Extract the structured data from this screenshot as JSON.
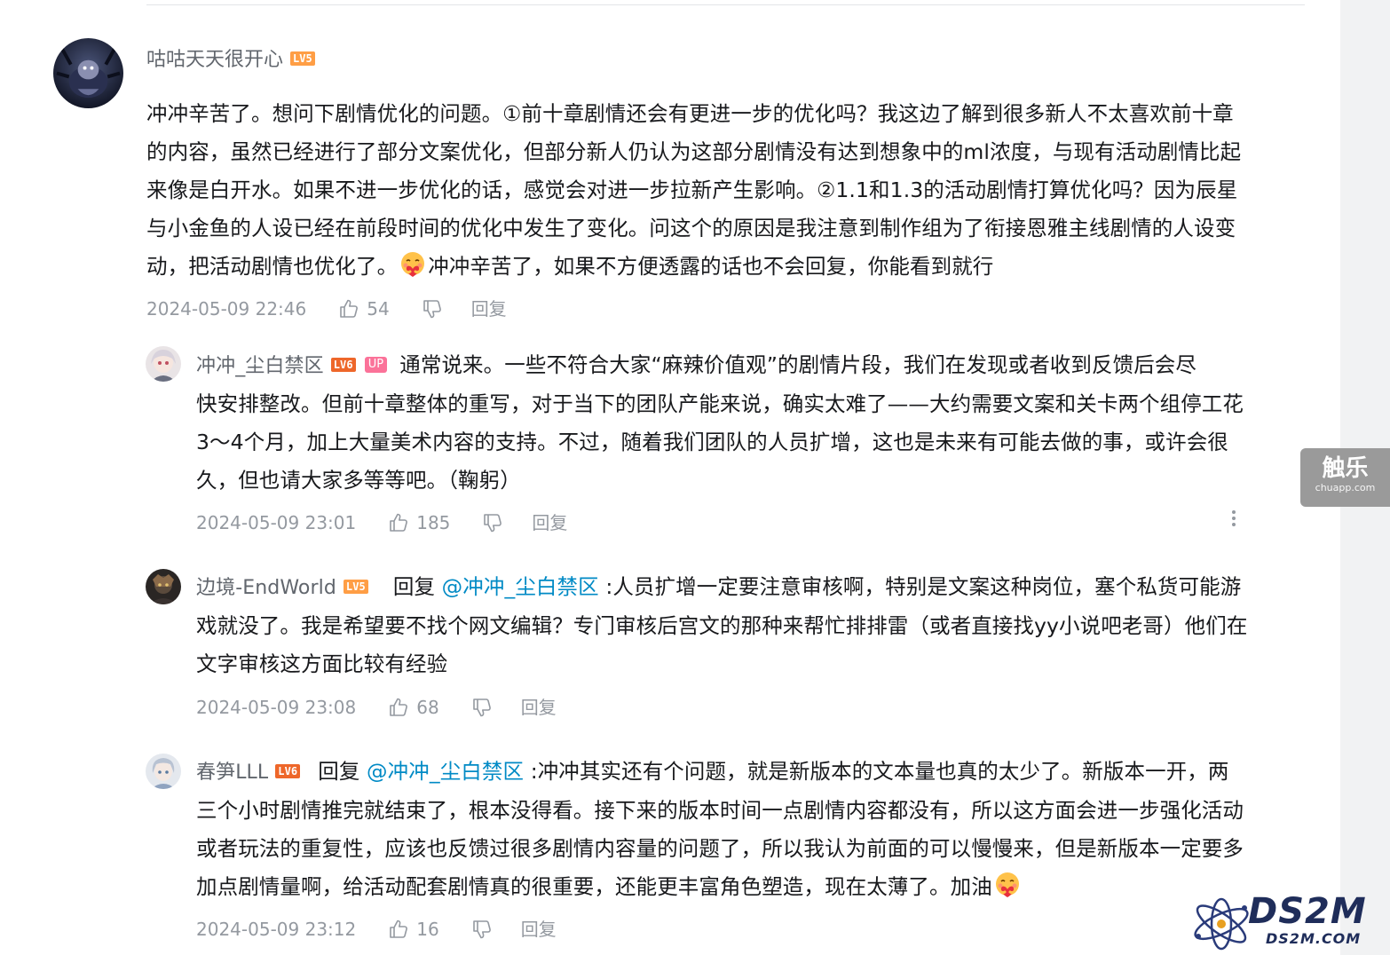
{
  "comments": [
    {
      "username": "咕咕天天很开心",
      "level": "LV5",
      "text_lines": [
        "冲冲辛苦了。想问下剧情优化的问题。①前十章剧情还会有更进一步的优化吗？我这边了解到很多新人不太喜欢前十章",
        "的内容，虽然已经进行了部分文案优化，但部分新人仍认为这部分剧情没有达到想象中的ml浓度，与现有活动剧情比起",
        "来像是白开水。如果不进一步优化的话，感觉会对进一步拉新产生影响。②1.1和1.3的活动剧情打算优化吗？因为辰星",
        "与小金鱼的人设已经在前段时间的优化中发生了变化。问这个的原因是我注意到制作组为了衔接恩雅主线剧情的人设变"
      ],
      "last_line_before_emoji": "动，把活动剧情也优化了。",
      "last_line_after_emoji": "冲冲辛苦了，如果不方便透露的话也不会回复，你能看到就行",
      "time": "2024-05-09 22:46",
      "likes": "54",
      "reply_label": "回复"
    },
    {
      "username": "冲冲_尘白禁区",
      "level": "LV6",
      "up_tag": "UP",
      "first_line": "通常说来。一些不符合大家“麻辣价值观”的剧情片段，我们在发现或者收到反馈后会尽",
      "text_lines": [
        "快安排整改。但前十章整体的重写，对于当下的团队产能来说，确实太难了——大约需要文案和关卡两个组停工花",
        "3～4个月，加上大量美术内容的支持。不过，随着我们团队的人员扩增，这也是未来有可能去做的事，或许会很",
        "久，但也请大家多等等吧。（鞠躬）"
      ],
      "time": "2024-05-09 23:01",
      "likes": "185",
      "reply_label": "回复"
    },
    {
      "username": "边境-EndWorld",
      "level": "LV5",
      "reply_prefix": "回复",
      "mention": "@冲冲_尘白禁区",
      "first_line": ":人员扩增一定要注意审核啊，特别是文案这种岗位，塞个私货可能游",
      "text_lines": [
        "戏就没了。我是希望要不找个网文编辑？专门审核后宫文的那种来帮忙排排雷（或者直接找yy小说吧老哥）他们在",
        "文字审核这方面比较有经验"
      ],
      "time": "2024-05-09 23:08",
      "likes": "68",
      "reply_label": "回复"
    },
    {
      "username": "春笋LLL",
      "level": "LV6",
      "reply_prefix": "回复",
      "mention": "@冲冲_尘白禁区",
      "first_line": ":冲冲其实还有个问题，就是新版本的文本量也真的太少了。新版本一开，两",
      "text_lines": [
        "三个小时剧情推完就结束了，根本没得看。接下来的版本时间一点剧情内容都没有，所以这方面会进一步强化活动",
        "或者玩法的重复性，应该也反馈过很多剧情内容量的问题了，所以我认为前面的可以慢慢来，但是新版本一定要多"
      ],
      "last_line_before_emoji": "加点剧情量啊，给活动配套剧情真的很重要，还能更丰富角色塑造，现在太薄了。加油",
      "time": "2024-05-09 23:12",
      "likes": "16",
      "reply_label": "回复"
    }
  ],
  "side_badge": {
    "cn": "触乐",
    "en": "chuapp.com"
  },
  "watermark": {
    "main": "DS2M",
    "sub": "DS2M.COM"
  },
  "icons": {
    "like": "thumbs-up-icon",
    "dislike": "thumbs-down-icon",
    "more": "more-vertical-icon",
    "emoji": "heart-hug-emoji-icon"
  },
  "colors": {
    "text": "#18191c",
    "username": "#61666d",
    "meta": "#9499a0",
    "mention": "#008ac5",
    "lv5": "#ff9e45",
    "lv6": "#ee672a",
    "up_tag": "#fb7299"
  }
}
